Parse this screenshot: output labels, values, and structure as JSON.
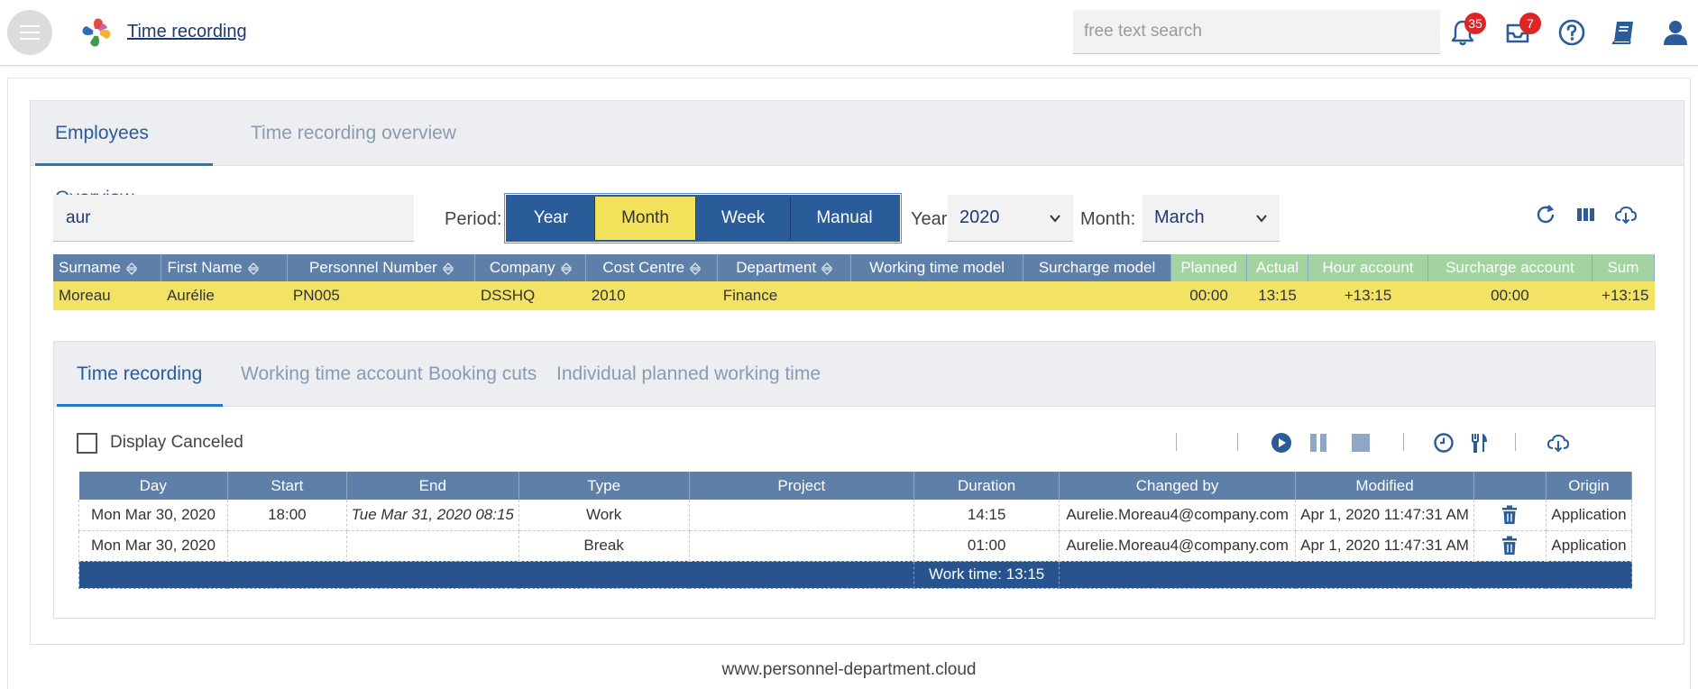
{
  "header": {
    "app_title": "Time recording",
    "search_placeholder": "free text search",
    "notifications_count": "35",
    "inbox_count": "7",
    "icons": [
      "menu-icon",
      "app-logo",
      "bell-icon",
      "inbox-icon",
      "help-icon",
      "book-icon",
      "user-icon"
    ]
  },
  "main_tabs": [
    {
      "label": "Employees Overview",
      "active": true
    },
    {
      "label": "Time recording overview",
      "active": false
    }
  ],
  "filters": {
    "employee_search_value": "aur",
    "period_label": "Period:",
    "periods": [
      "Year",
      "Month",
      "Week",
      "Manual"
    ],
    "selected_period": "Month",
    "year_label": "Year:",
    "year_value": "2020",
    "month_label": "Month:",
    "month_value": "March"
  },
  "employee_table": {
    "columns": [
      "Surname",
      "First Name",
      "Personnel Number",
      "Company",
      "Cost Centre",
      "Department",
      "Working time model",
      "Surcharge model",
      "Planned",
      "Actual",
      "Hour account",
      "Surcharge account",
      "Sum"
    ],
    "rows": [
      [
        "Moreau",
        "Aurélie",
        "PN005",
        "DSSHQ",
        "2010",
        "Finance",
        "",
        "",
        "00:00",
        "13:15",
        "+13:15",
        "00:00",
        "+13:15"
      ]
    ]
  },
  "sub_tabs": [
    {
      "label": "Time recording",
      "active": true
    },
    {
      "label": "Working time account",
      "active": false
    },
    {
      "label": "Booking cuts",
      "active": false
    },
    {
      "label": "Individual planned working time",
      "active": false
    }
  ],
  "time_recording": {
    "display_canceled_label": "Display Canceled",
    "columns": [
      "Day",
      "Start",
      "End",
      "Type",
      "Project",
      "Duration",
      "Changed by",
      "Modified",
      "",
      "Origin"
    ],
    "rows": [
      [
        "Mon Mar 30, 2020",
        "18:00",
        "Tue Mar 31, 2020 08:15",
        "Work",
        "",
        "14:15",
        "Aurelie.Moreau4@company.com",
        "Apr 1, 2020 11:47:31 AM",
        "",
        "Application"
      ],
      [
        "Mon Mar 30, 2020",
        "",
        "",
        "Break",
        "",
        "01:00",
        "Aurelie.Moreau4@company.com",
        "Apr 1, 2020 11:47:31 AM",
        "",
        "Application"
      ]
    ],
    "summary": "Work time: 13:15"
  },
  "footer": {
    "text": "www.personnel-department.cloud"
  },
  "colors": {
    "accent": "#2a5c9a",
    "header_blue": "#5e7fa8",
    "header_green": "#a3d3a0",
    "highlight_yellow": "#f3e365",
    "badge_red": "#e02424"
  }
}
